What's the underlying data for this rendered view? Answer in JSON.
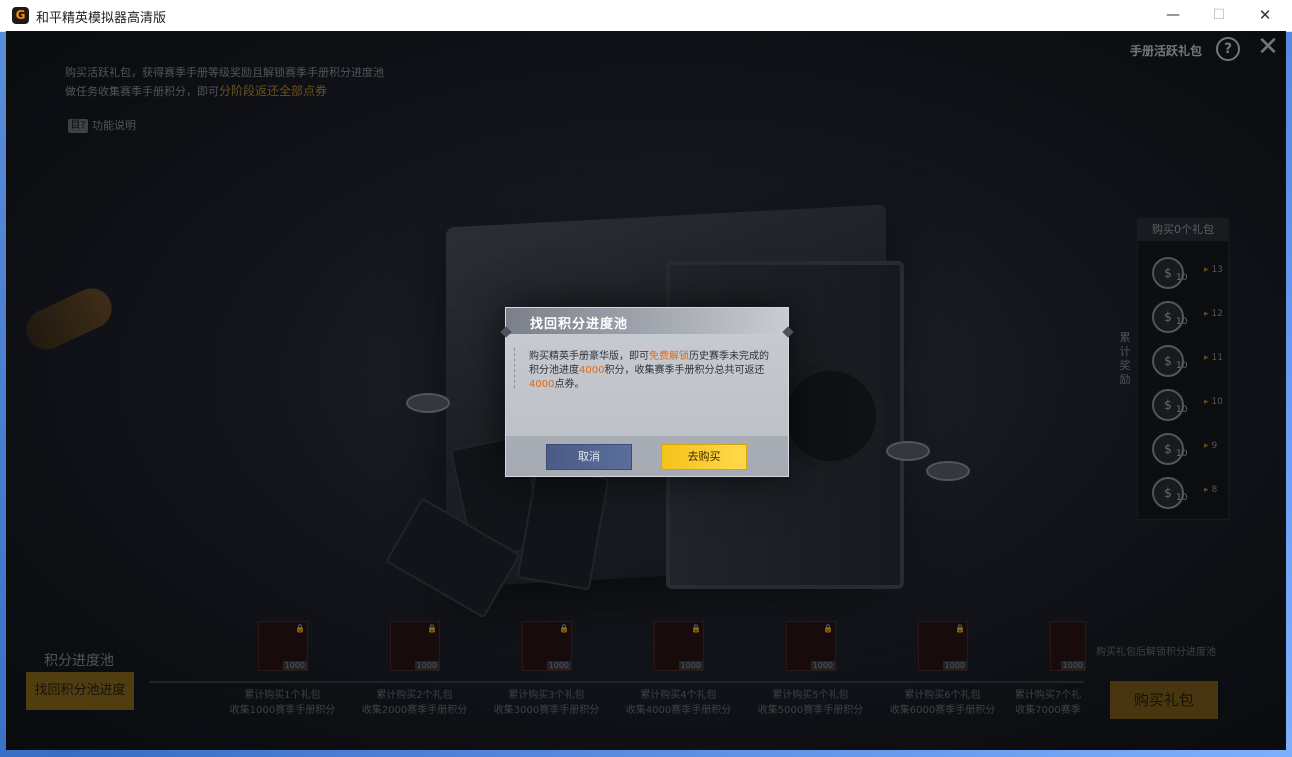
{
  "window": {
    "title": "和平精英模拟器高清版",
    "logo_glyph": "G",
    "min_glyph": "—",
    "max_glyph": "☐",
    "close_glyph": "✕"
  },
  "page": {
    "desc_line1": "购买活跃礼包，获得赛季手册等级奖励且解锁赛季手册积分进度池",
    "desc_line2_prefix": "做任务收集赛季手册积分，即可",
    "desc_highlight": "分阶段返还全部点券",
    "func_icon_glyph": "目?",
    "func_label": "功能说明",
    "topright_label": "手册活跃礼包",
    "help_glyph": "?",
    "close_glyph": "✕"
  },
  "rewards": {
    "title": "购买0个礼包",
    "side_label": "累计奖励",
    "coin_glyph": "$",
    "items": [
      {
        "qty": "10",
        "level": "13"
      },
      {
        "qty": "10",
        "level": "12"
      },
      {
        "qty": "10",
        "level": "11"
      },
      {
        "qty": "10",
        "level": "10"
      },
      {
        "qty": "10",
        "level": "9"
      },
      {
        "qty": "10",
        "level": "8"
      }
    ]
  },
  "progress": {
    "pool_label": "积分进度池",
    "retrieve_button": "找回积分池进度",
    "right_hint": "购买礼包后解锁积分进度池",
    "buy_pack_button": "购买礼包",
    "lock_glyph": "🔒",
    "tiers": [
      {
        "badge": "1000",
        "line1": "累计购买1个礼包",
        "line2": "收集1000赛季手册积分"
      },
      {
        "badge": "1000",
        "line1": "累计购买2个礼包",
        "line2": "收集2000赛季手册积分"
      },
      {
        "badge": "1000",
        "line1": "累计购买3个礼包",
        "line2": "收集3000赛季手册积分"
      },
      {
        "badge": "1000",
        "line1": "累计购买4个礼包",
        "line2": "收集4000赛季手册积分"
      },
      {
        "badge": "1000",
        "line1": "累计购买5个礼包",
        "line2": "收集5000赛季手册积分"
      },
      {
        "badge": "1000",
        "line1": "累计购买6个礼包",
        "line2": "收集6000赛季手册积分"
      },
      {
        "badge": "1000",
        "line1": "累计购买7个礼",
        "line2": "收集7000赛季"
      }
    ]
  },
  "modal": {
    "title": "找回积分进度池",
    "body_p1": "购买精英手册豪华版，即可",
    "body_h1": "免费解锁",
    "body_p2": "历史赛季未完成的积分池进度",
    "body_h2": "4000",
    "body_p3": "积分，收集赛季手册积分总共可返还",
    "body_h3": "4000",
    "body_p4": "点券。",
    "cancel": "取消",
    "buy": "去购买"
  }
}
